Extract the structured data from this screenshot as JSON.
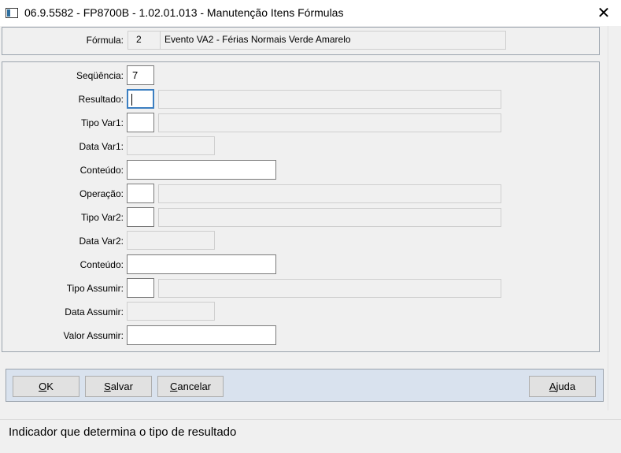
{
  "window": {
    "title": "06.9.5582 - FP8700B - 1.02.01.013 - Manutenção Itens Fórmulas",
    "close_glyph": "✕"
  },
  "header": {
    "formula_label": "Fórmula:",
    "formula_number": "2",
    "formula_description": "Evento VA2 - Férias Normais Verde Amarelo"
  },
  "form": {
    "sequencia_label": "Seqüência:",
    "sequencia_value": "7",
    "resultado_label": "Resultado:",
    "tipo_var1_label": "Tipo Var1:",
    "data_var1_label": "Data Var1:",
    "conteudo1_label": "Conteúdo:",
    "operacao_label": "Operação:",
    "tipo_var2_label": "Tipo Var2:",
    "data_var2_label": "Data Var2:",
    "conteudo2_label": "Conteúdo:",
    "tipo_assumir_label": "Tipo Assumir:",
    "data_assumir_label": "Data Assumir:",
    "valor_assumir_label": "Valor Assumir:"
  },
  "buttons": {
    "ok_mnemonic": "O",
    "ok_rest": "K",
    "salvar_mnemonic": "S",
    "salvar_rest": "alvar",
    "cancelar_mnemonic": "C",
    "cancelar_rest": "ancelar",
    "ajuda_mnemonic": "A",
    "ajuda_rest": "juda"
  },
  "status": {
    "text": "Indicador que determina o tipo de resultado"
  },
  "colors": {
    "button_panel": "#d9e2ee",
    "focus_border": "#3c7fc1"
  }
}
